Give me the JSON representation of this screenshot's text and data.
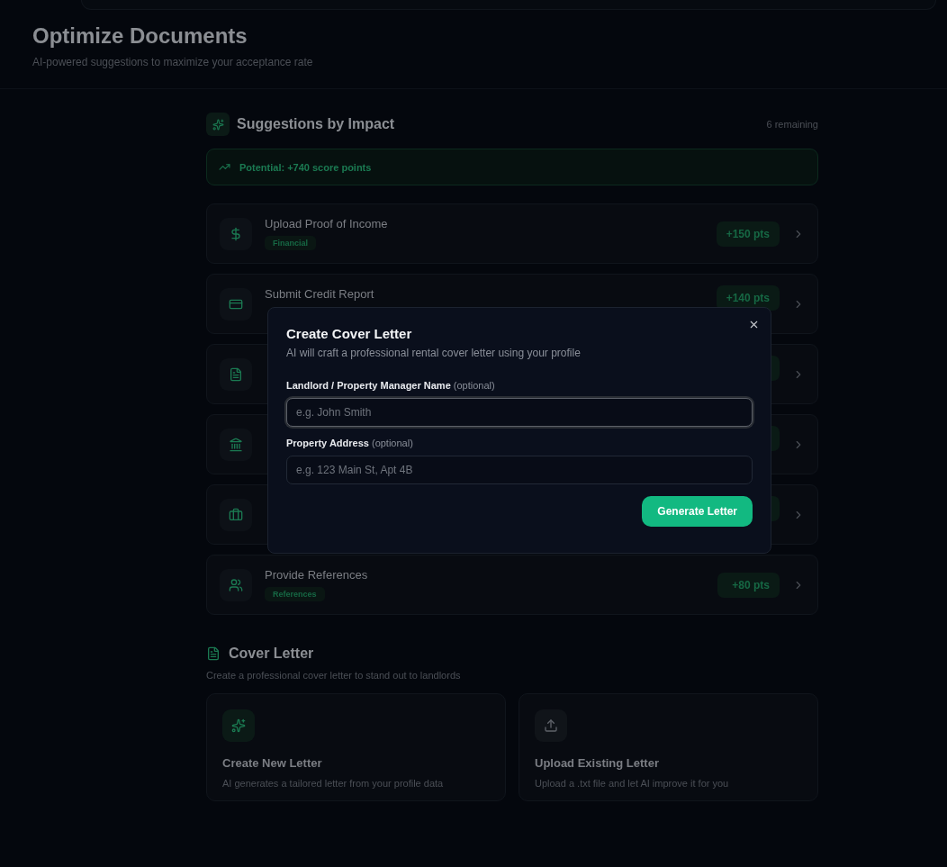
{
  "page": {
    "title": "Optimize Documents",
    "subtitle": "AI-powered suggestions to maximize your acceptance rate"
  },
  "suggestions": {
    "title": "Suggestions by Impact",
    "remaining": "6 remaining",
    "potential": "Potential: +740 score points",
    "items": [
      {
        "kind": "full",
        "title": "Upload Proof of Income",
        "tag": "Financial",
        "points": "+150 pts"
      },
      {
        "kind": "full",
        "title": "Submit Credit Report",
        "points": "+140 pts"
      },
      {
        "kind": "covered"
      },
      {
        "kind": "covered"
      },
      {
        "kind": "covered"
      },
      {
        "kind": "full",
        "title": "Provide References",
        "tag": "References",
        "points": "+80 pts"
      }
    ]
  },
  "cover_letter": {
    "title": "Cover Letter",
    "subtitle": "Create a professional cover letter to stand out to landlords",
    "cards": [
      {
        "title": "Create New Letter",
        "description": "AI generates a tailored letter from your profile data",
        "accent": true
      },
      {
        "title": "Upload Existing Letter",
        "description": "Upload a .txt file and let AI improve it for you",
        "accent": false
      }
    ]
  },
  "modal": {
    "title": "Create Cover Letter",
    "subtitle": "AI will craft a professional rental cover letter using your profile",
    "fields": [
      {
        "label": "Landlord / Property Manager Name",
        "hint": "(optional)",
        "placeholder": "e.g. John Smith",
        "focused": true
      },
      {
        "label": "Property Address",
        "hint": "(optional)",
        "placeholder": "e.g. 123 Main St, Apt 4B",
        "focused": false
      }
    ],
    "button": "Generate Letter"
  }
}
